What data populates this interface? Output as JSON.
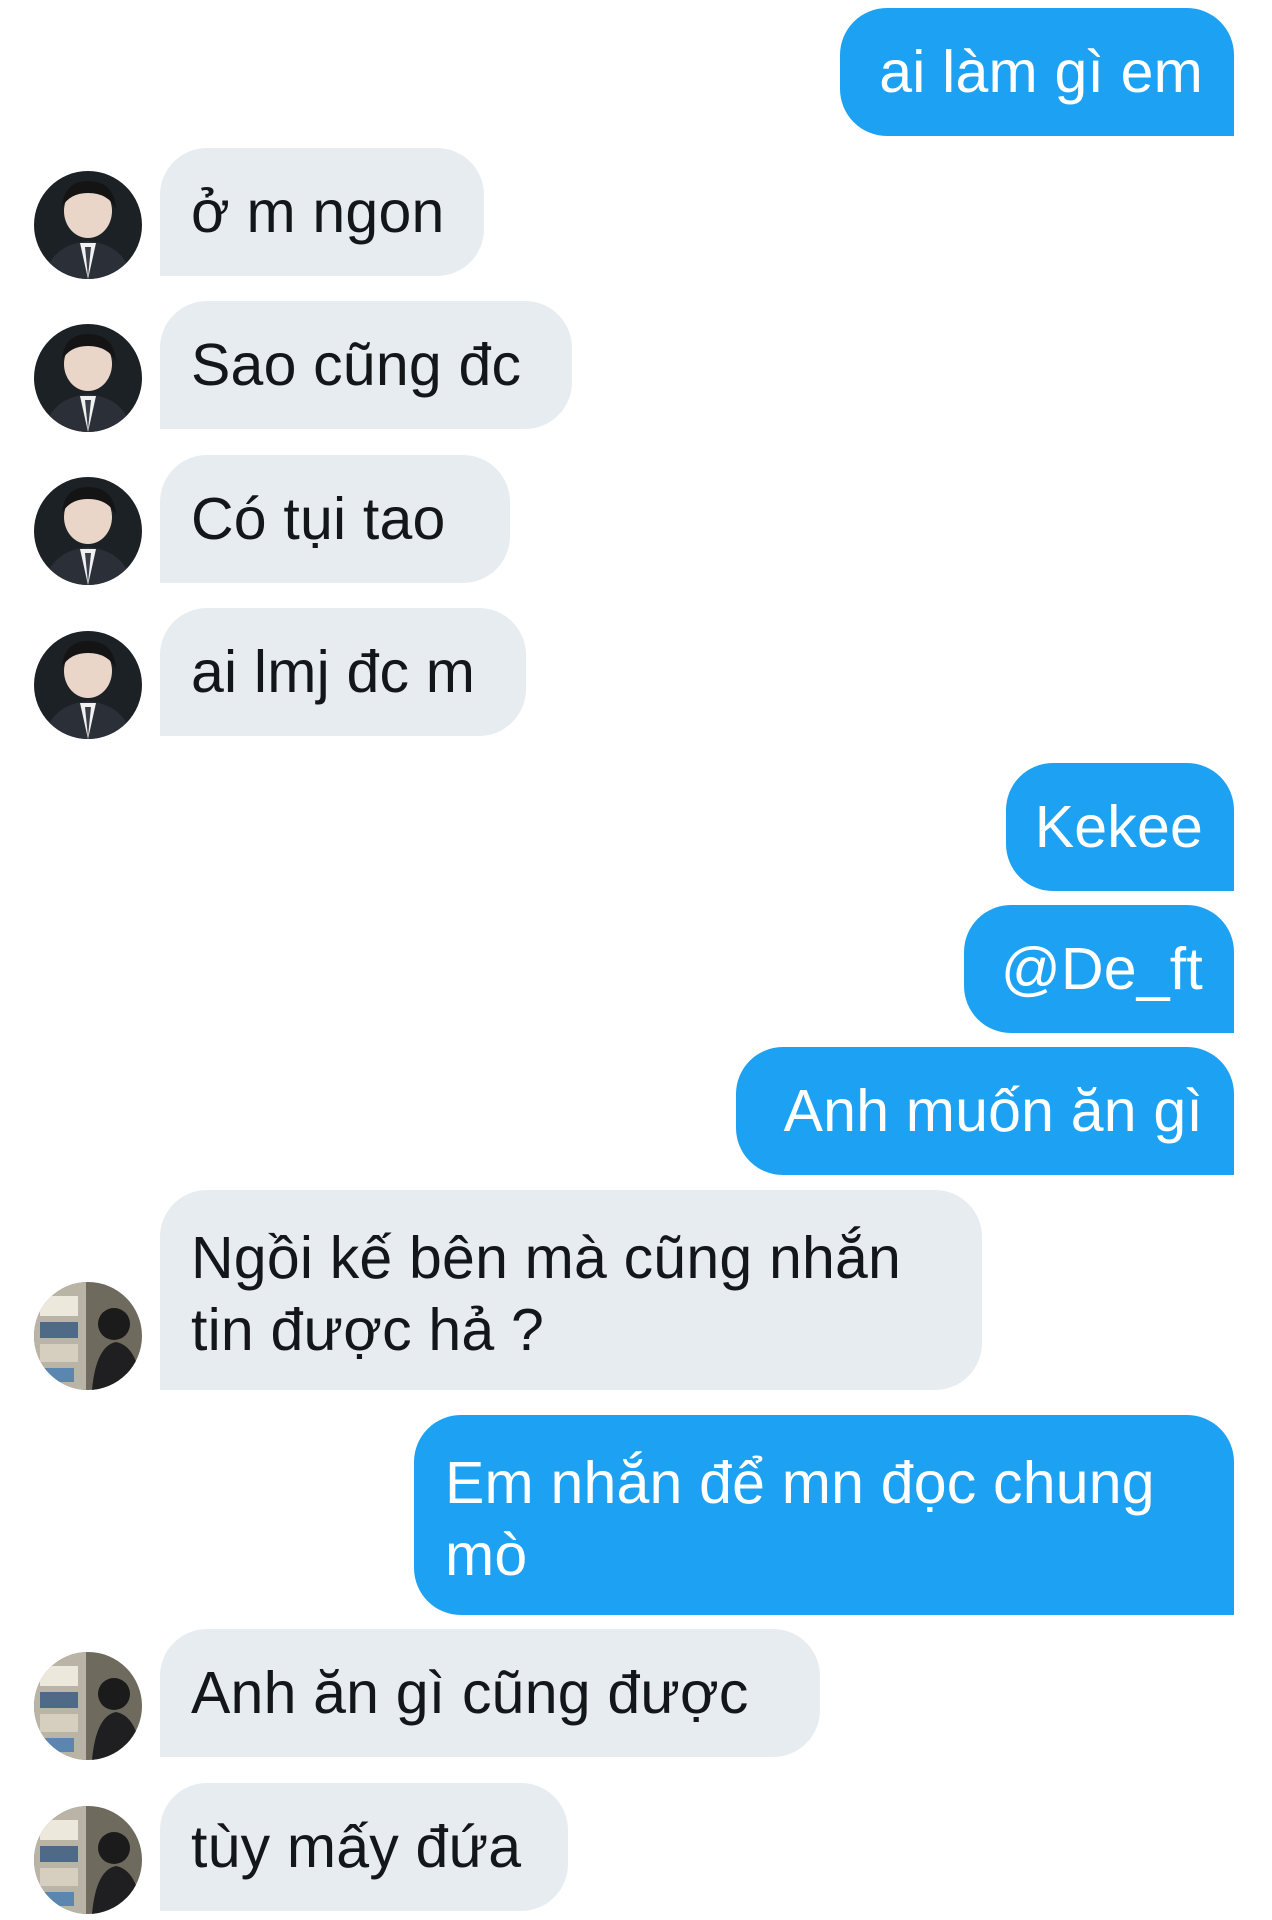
{
  "conversation": {
    "messages": [
      {
        "id": "m1",
        "direction": "sent",
        "text": "ai làm gì em"
      },
      {
        "id": "m2",
        "direction": "received",
        "avatar": "user-a-avatar",
        "text": "ở m ngon"
      },
      {
        "id": "m3",
        "direction": "received",
        "avatar": "user-a-avatar",
        "text": "Sao cũng đc"
      },
      {
        "id": "m4",
        "direction": "received",
        "avatar": "user-a-avatar",
        "text": "Có tụi tao"
      },
      {
        "id": "m5",
        "direction": "received",
        "avatar": "user-a-avatar",
        "text": "ai lmj đc m"
      },
      {
        "id": "m6",
        "direction": "sent",
        "text": "Kekee"
      },
      {
        "id": "m7",
        "direction": "sent",
        "text": "@De_ft"
      },
      {
        "id": "m8",
        "direction": "sent",
        "text": "Anh muốn ăn gì"
      },
      {
        "id": "m9",
        "direction": "received",
        "avatar": "user-b-avatar",
        "lines": [
          "Ngồi kế bên mà cũng nhắn",
          "tin được hả ?"
        ]
      },
      {
        "id": "m10",
        "direction": "sent",
        "lines": [
          "Em nhắn để mn đọc chung",
          "mò"
        ]
      },
      {
        "id": "m11",
        "direction": "received",
        "avatar": "user-b-avatar",
        "text": "Anh ăn gì cũng được"
      },
      {
        "id": "m12",
        "direction": "received",
        "avatar": "user-b-avatar",
        "text": "tùy mấy đứa"
      }
    ]
  },
  "colors": {
    "sent_bubble": "#1da1f2",
    "received_bubble": "#e6ecf0",
    "sent_text": "#ffffff",
    "received_text": "#14171a"
  }
}
